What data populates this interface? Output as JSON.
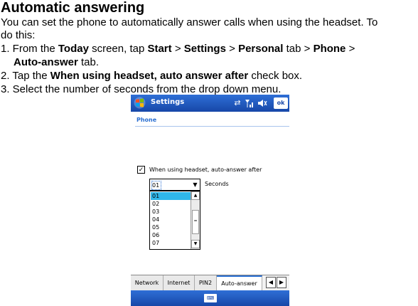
{
  "heading": "Automatic answering",
  "intro_line1": "You can set the phone to automatically answer calls when using the headset. To",
  "intro_line2": "do this:",
  "step1": {
    "num": "1. From the ",
    "b1": "Today",
    "t1": " screen, tap ",
    "b2": "Start",
    "t2": " > ",
    "b3": "Settings",
    "t3": " > ",
    "b4": "Personal",
    "t4": " tab > ",
    "b5": "Phone",
    "t5": " >",
    "b6": "Auto-answer",
    "t6": " tab."
  },
  "step2": {
    "num": "2. Tap the ",
    "b1": "When using headset, auto answer after",
    "t1": " check box."
  },
  "step3": "3. Select the number of seconds from the drop down menu.",
  "phone": {
    "title": "Settings",
    "ok_label": "ok",
    "section": "Phone",
    "checkbox_label": "When using headset, auto-answer after",
    "checkbox_checked": true,
    "combo_value": "01",
    "seconds_label": "Seconds",
    "options": [
      "01",
      "02",
      "03",
      "04",
      "05",
      "06",
      "07"
    ],
    "selected_option": "01",
    "tabs": [
      "Network",
      "Internet",
      "PIN2",
      "Auto-answer"
    ],
    "active_tab": "Auto-answer",
    "icons": [
      "windows-start-icon",
      "connectivity-icon",
      "signal-icon",
      "volume-icon",
      "keyboard-icon"
    ],
    "accent_color": "#2a6fd2",
    "titlebar_color": "#1747a8"
  }
}
